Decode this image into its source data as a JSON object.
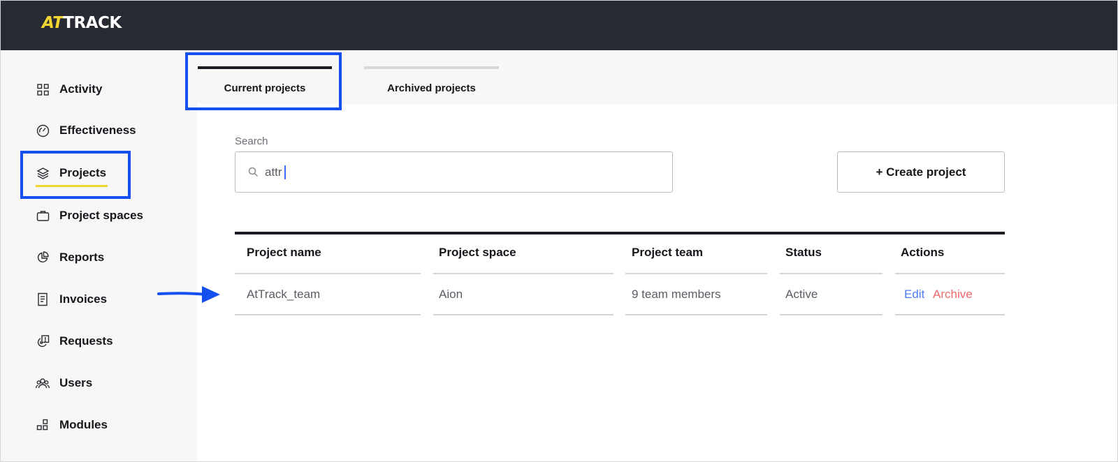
{
  "brand": {
    "logo_prefix": "AT",
    "logo_suffix": "TRACK"
  },
  "sidebar": {
    "items": [
      {
        "label": "Activity",
        "icon": "grid-icon"
      },
      {
        "label": "Effectiveness",
        "icon": "gauge-icon"
      },
      {
        "label": "Projects",
        "icon": "layers-icon",
        "active": true
      },
      {
        "label": "Project spaces",
        "icon": "briefcase-icon"
      },
      {
        "label": "Reports",
        "icon": "pie-chart-icon"
      },
      {
        "label": "Invoices",
        "icon": "receipt-icon"
      },
      {
        "label": "Requests",
        "icon": "request-icon"
      },
      {
        "label": "Users",
        "icon": "users-icon"
      },
      {
        "label": "Modules",
        "icon": "modules-icon"
      }
    ]
  },
  "tabs": [
    {
      "label": "Current projects",
      "active": true
    },
    {
      "label": "Archived projects",
      "active": false
    }
  ],
  "search": {
    "label": "Search",
    "value": "attr"
  },
  "toolbar": {
    "create_label": "+ Create project"
  },
  "table": {
    "columns": [
      "Project name",
      "Project space",
      "Project team",
      "Status",
      "Actions"
    ],
    "rows": [
      {
        "name": "AtTrack_team",
        "space": "Aion",
        "team": "9 team members",
        "status": "Active",
        "edit": "Edit",
        "archive": "Archive"
      }
    ]
  },
  "colors": {
    "topbar": "#272a33",
    "brand_accent": "#f2d530",
    "highlight": "#1450f0",
    "link_edit": "#4d7ef2",
    "link_archive": "#ee6a6a"
  }
}
